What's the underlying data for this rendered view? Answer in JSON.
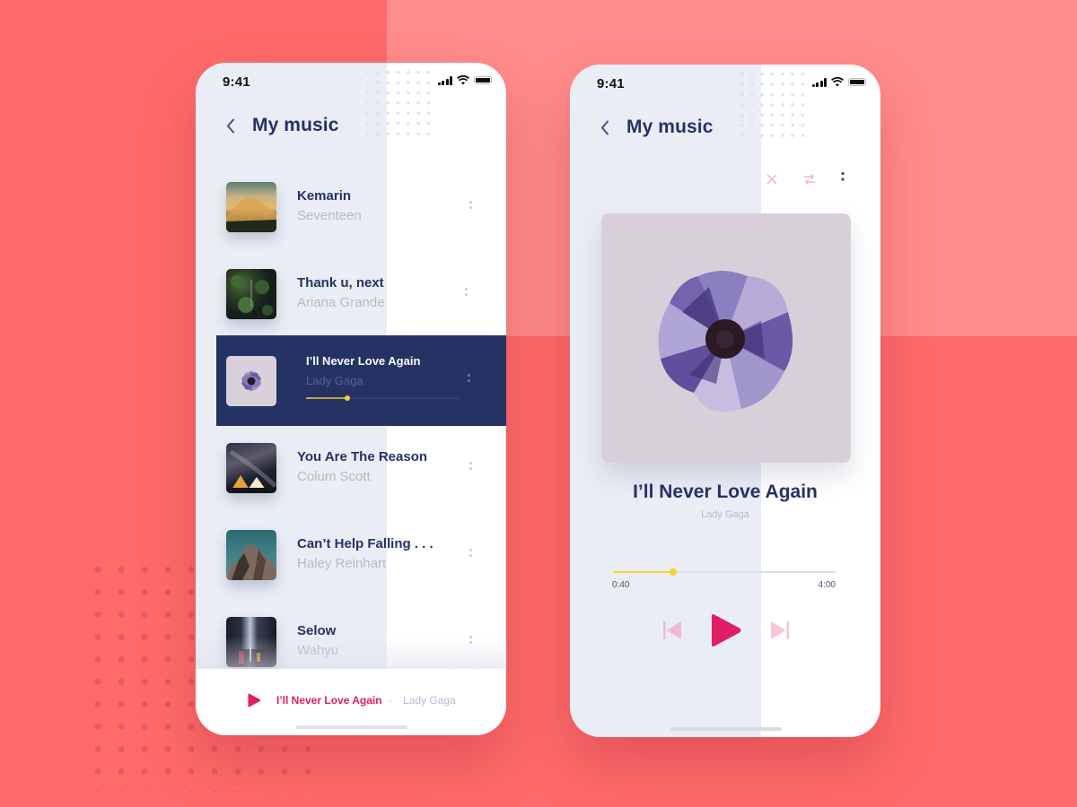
{
  "colors": {
    "background": "#ff6b6b",
    "background_light": "#ff8d8b",
    "navy": "#253264",
    "accent": "#e01e63",
    "progress": "#f5d22a"
  },
  "status_bar": {
    "time": "9:41"
  },
  "list_screen": {
    "title": "My music",
    "back_icon": "chevron-left-icon",
    "songs": [
      {
        "title": "Kemarin",
        "artist": "Seventeen",
        "art": "mountain-sunset"
      },
      {
        "title": "Thank u, next",
        "artist": "Ariana Grande",
        "art": "forest"
      },
      {
        "title": "I’ll Never Love Again",
        "artist": "Lady Gaga",
        "art": "purple-flower",
        "active": true,
        "progress": 0.27
      },
      {
        "title": "You Are The Reason",
        "artist": "Colum Scott",
        "art": "night-camping"
      },
      {
        "title": "Can’t Help Falling . . .",
        "artist": "Haley Reinhart",
        "art": "rocky-peak"
      },
      {
        "title": "Selow",
        "artist": "Wahyu",
        "art": "city-rain"
      }
    ],
    "mini_player": {
      "title": "I’ll Never Love Again",
      "separator": "-",
      "artist": "Lady Gaga",
      "play_icon": "play-icon"
    }
  },
  "player_screen": {
    "title": "My music",
    "back_icon": "chevron-left-icon",
    "options": [
      "shuffle-icon",
      "repeat-icon",
      "more-icon"
    ],
    "now_playing": {
      "title": "I’ll Never Love Again",
      "artist": "Lady Gaga",
      "art": "purple-flower"
    },
    "progress": {
      "current": "0:40",
      "total": "4:00",
      "fraction": 0.27
    },
    "controls": [
      "previous-icon",
      "play-icon",
      "next-icon"
    ]
  }
}
